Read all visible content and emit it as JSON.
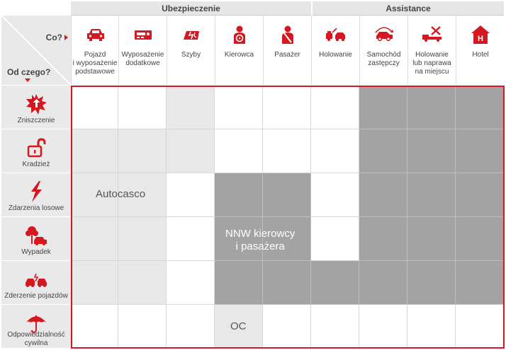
{
  "groups": {
    "insurance": "Ubezpieczenie",
    "assistance": "Assistance"
  },
  "corner": {
    "columns_label": "Co?",
    "rows_label": "Od czego?"
  },
  "columns": [
    {
      "label": "Pojazd\ni wyposażenie\npodstawowe",
      "icon": "car-icon"
    },
    {
      "label": "Wyposażenie\ndodatkowe",
      "icon": "car-radio-icon"
    },
    {
      "label": "Szyby",
      "icon": "broken-glass-icon"
    },
    {
      "label": "Kierowca",
      "icon": "driver-icon"
    },
    {
      "label": "Pasażer",
      "icon": "seatbelt-icon"
    },
    {
      "label": "Holowanie",
      "icon": "tow-truck-icon"
    },
    {
      "label": "Samochód\nzastępczy",
      "icon": "replacement-car-icon"
    },
    {
      "label": "Holowanie\nlub naprawa\nna miejscu",
      "icon": "repair-truck-icon"
    },
    {
      "label": "Hotel",
      "icon": "hotel-icon"
    }
  ],
  "rows": [
    {
      "label": "Zniszczenie",
      "icon": "explosion-icon"
    },
    {
      "label": "Kradzież",
      "icon": "padlock-icon"
    },
    {
      "label": "Zdarzenia losowe",
      "icon": "lightning-icon"
    },
    {
      "label": "Wypadek",
      "icon": "accident-tree-icon"
    },
    {
      "label": "Zderzenie pojazdów",
      "icon": "collision-icon"
    },
    {
      "label": "Odpowiedzialność\ncywilna",
      "icon": "umbrella-icon"
    }
  ],
  "matrix": [
    [
      "w",
      "w",
      "l",
      "w",
      "w",
      "w",
      "d",
      "d",
      "d"
    ],
    [
      "l",
      "l",
      "l",
      "w",
      "w",
      "w",
      "d",
      "d",
      "d"
    ],
    [
      "l",
      "l",
      "w",
      "d",
      "d",
      "w",
      "d",
      "d",
      "d"
    ],
    [
      "l",
      "l",
      "w",
      "d",
      "d",
      "w",
      "d",
      "d",
      "d"
    ],
    [
      "l",
      "l",
      "w",
      "d",
      "d",
      "d",
      "d",
      "d",
      "d"
    ],
    [
      "w",
      "w",
      "w",
      "l",
      "w",
      "w",
      "w",
      "w",
      "w"
    ]
  ],
  "areas": {
    "autocasco": "Autocasco",
    "nnw_line1": "NNW kierowcy",
    "nnw_line2": "i pasażera",
    "oc": "OC"
  },
  "colors": {
    "accent": "#d5181f",
    "light": "#e8e8e8",
    "dark": "#a3a3a3"
  }
}
